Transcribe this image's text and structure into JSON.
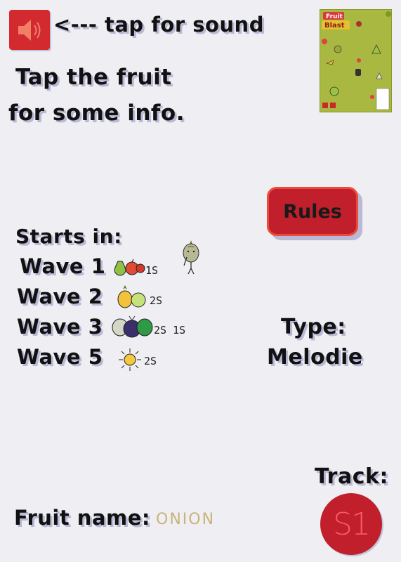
{
  "sound": {
    "hint": "<--- tap for sound"
  },
  "intro": {
    "line1": "Tap the fruit",
    "line2": "for some info."
  },
  "thumbnail": {
    "title": "Fruit Blast"
  },
  "rules_button": {
    "label": "Rules"
  },
  "starts": {
    "heading": "Starts in:",
    "waves": [
      {
        "label": "Wave 1",
        "times": "1S",
        "icons": [
          "pear-icon",
          "apple-icon"
        ]
      },
      {
        "label": "Wave 2",
        "times": "2S",
        "icons": [
          "pineapple-icon",
          "green-apple-icon"
        ]
      },
      {
        "label": "Wave 3",
        "times": "2S 1S",
        "icons": [
          "grape-icon",
          "berry-icon",
          "melon-icon"
        ]
      },
      {
        "label": "Wave 5",
        "times": "2S",
        "icons": [
          "sun-icon"
        ]
      }
    ]
  },
  "type": {
    "label": "Type:",
    "value": "Melodie"
  },
  "track": {
    "label": "Track:",
    "value": "S1"
  },
  "fruit": {
    "label": "Fruit name:",
    "value": "ONION"
  },
  "colors": {
    "accent": "#d32a2f",
    "background": "#eeeef3",
    "shadow": "#b9b9d6",
    "fruit_name": "#c8b47a"
  }
}
